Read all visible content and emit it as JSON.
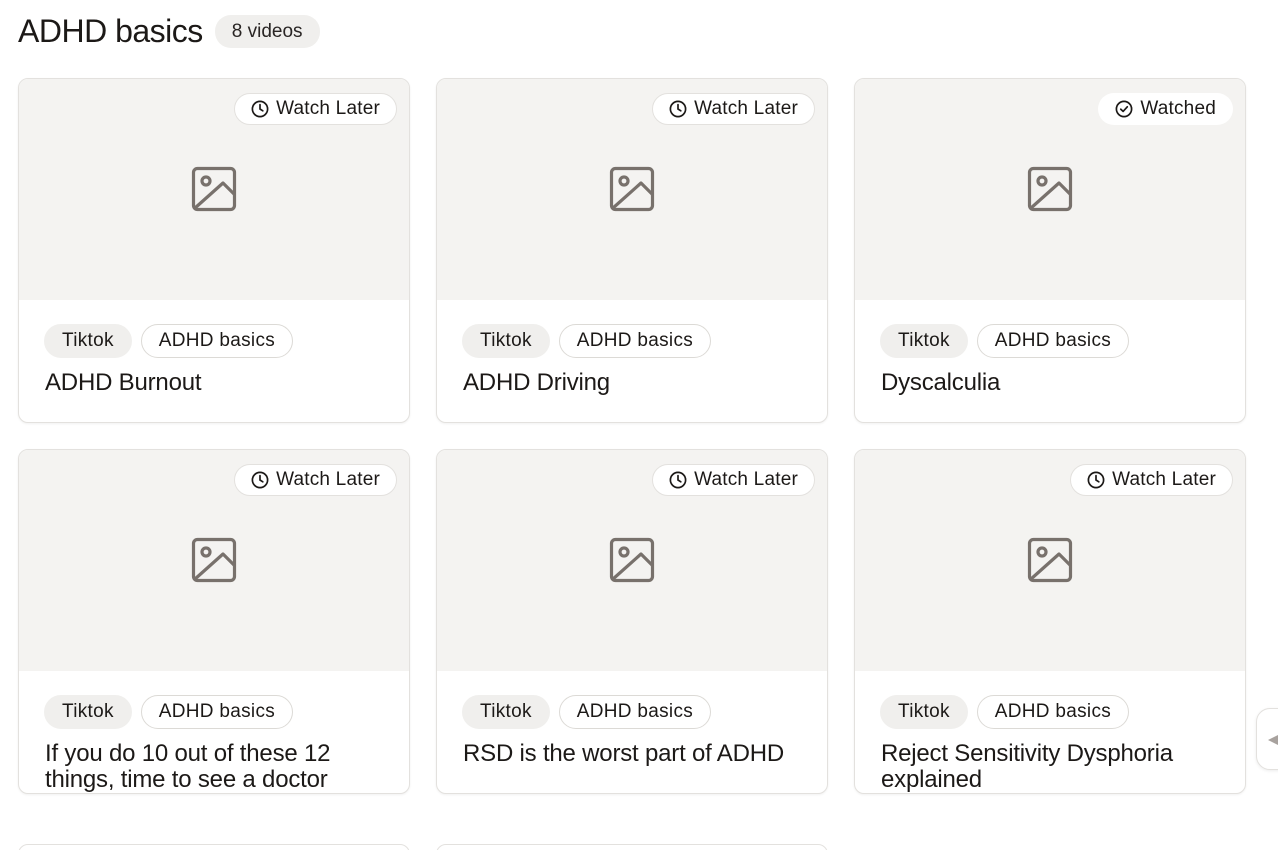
{
  "header": {
    "title": "ADHD basics",
    "count_badge": "8 videos"
  },
  "cards": [
    {
      "status": "Watch Later",
      "status_icon": "clock-icon",
      "platform": "Tiktok",
      "category": "ADHD basics",
      "title": "ADHD Burnout"
    },
    {
      "status": "Watch Later",
      "status_icon": "clock-icon",
      "platform": "Tiktok",
      "category": "ADHD basics",
      "title": "ADHD Driving"
    },
    {
      "status": "Watched",
      "status_icon": "check-circle-icon",
      "platform": "Tiktok",
      "category": "ADHD basics",
      "title": "Dyscalculia"
    },
    {
      "status": "Watch Later",
      "status_icon": "clock-icon",
      "platform": "Tiktok",
      "category": "ADHD basics",
      "title": "If you do 10 out of these 12 things, time to see a doctor"
    },
    {
      "status": "Watch Later",
      "status_icon": "clock-icon",
      "platform": "Tiktok",
      "category": "ADHD basics",
      "title": "RSD is the worst part of ADHD"
    },
    {
      "status": "Watch Later",
      "status_icon": "clock-icon",
      "platform": "Tiktok",
      "category": "ADHD basics",
      "title": "Reject Sensitivity Dysphoria explained"
    }
  ],
  "colors": {
    "thumbnail_bg": "#f4f3f1",
    "icon_gray": "#78716c",
    "tag_platform_bg": "#f0efed",
    "border": "#e3e1de",
    "text": "#1c1917"
  }
}
